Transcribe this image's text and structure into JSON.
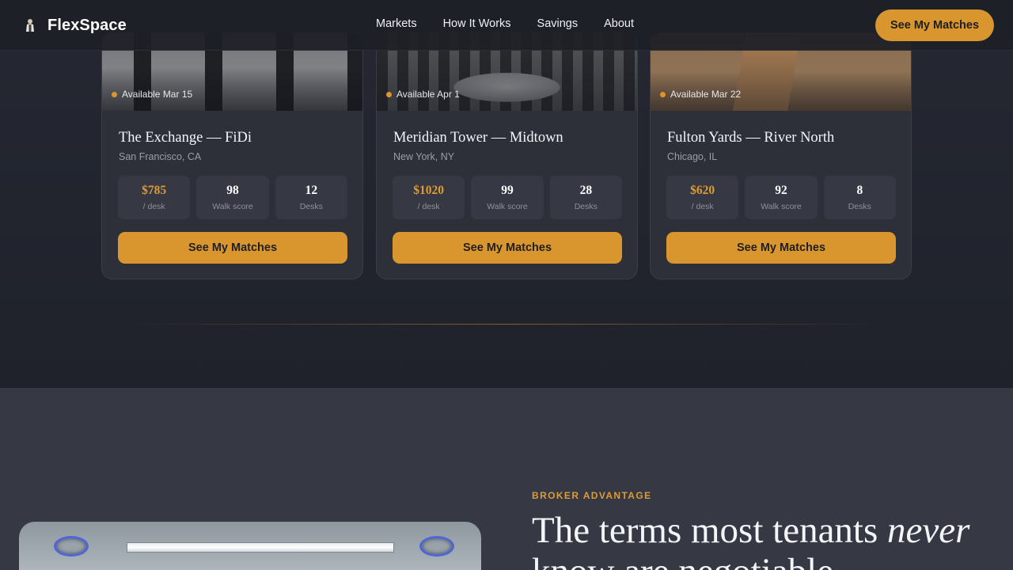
{
  "header": {
    "brand": "FlexSpace",
    "brand_icon": "person-icon",
    "nav": [
      "Markets",
      "How It Works",
      "Savings",
      "About"
    ],
    "cta": "See My Matches"
  },
  "cards": [
    {
      "availability": "Available Mar 15",
      "title": "The Exchange — FiDi",
      "location": "San Francisco, CA",
      "stats": [
        {
          "value": "$785",
          "label": "/ desk"
        },
        {
          "value": "98",
          "label": "Walk score"
        },
        {
          "value": "12",
          "label": "Desks"
        }
      ],
      "button": "See My Matches"
    },
    {
      "availability": "Available Apr 1",
      "title": "Meridian Tower — Midtown",
      "location": "New York, NY",
      "stats": [
        {
          "value": "$1020",
          "label": "/ desk"
        },
        {
          "value": "99",
          "label": "Walk score"
        },
        {
          "value": "28",
          "label": "Desks"
        }
      ],
      "button": "See My Matches"
    },
    {
      "availability": "Available Mar 22",
      "title": "Fulton Yards — River North",
      "location": "Chicago, IL",
      "stats": [
        {
          "value": "$620",
          "label": "/ desk"
        },
        {
          "value": "92",
          "label": "Walk score"
        },
        {
          "value": "8",
          "label": "Desks"
        }
      ],
      "button": "See My Matches"
    }
  ],
  "broker": {
    "eyebrow": "BROKER ADVANTAGE",
    "headline_start": "The terms most tenants ",
    "headline_em": "never",
    "headline_end": " know are negotiable"
  },
  "colors": {
    "accent": "#d9962e",
    "background": "#1e2129",
    "card": "#2d3039"
  }
}
